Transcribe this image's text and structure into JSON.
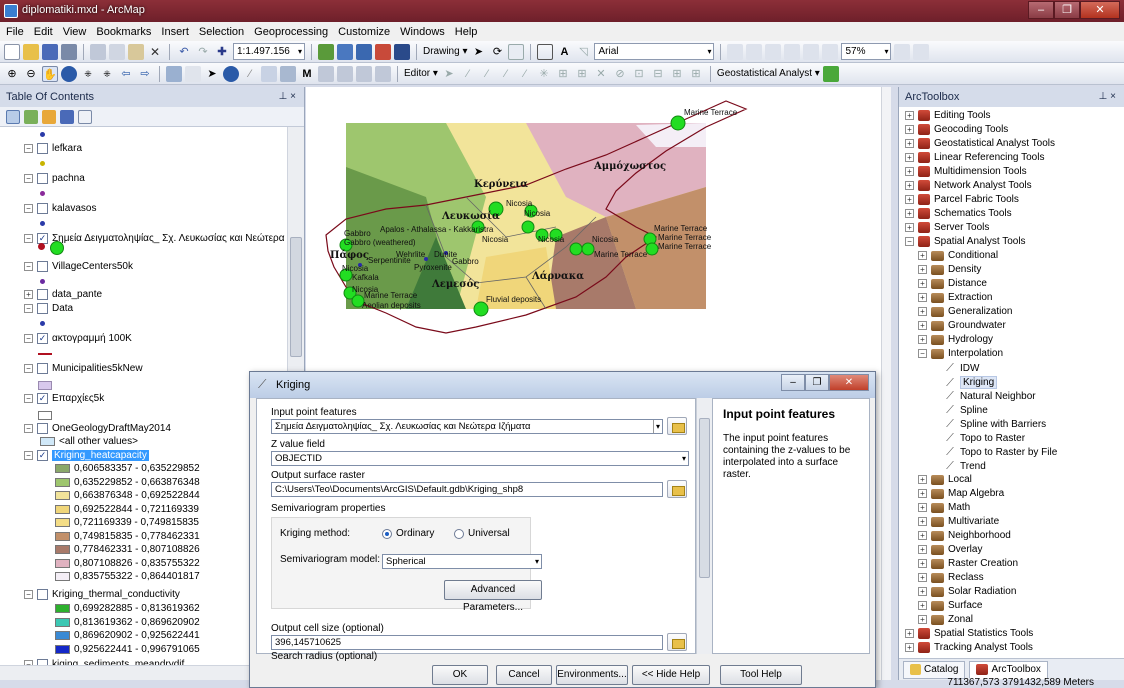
{
  "window": {
    "title": "diplomatiki.mxd - ArcMap",
    "controls": [
      "–",
      "❐",
      "✕"
    ]
  },
  "menu": [
    "File",
    "Edit",
    "View",
    "Bookmarks",
    "Insert",
    "Selection",
    "Geoprocessing",
    "Customize",
    "Windows",
    "Help"
  ],
  "toolbar": {
    "scale": "1:1.497.156",
    "drawing_label": "Drawing ▾",
    "font": "Arial",
    "zoom_percent": "57%",
    "editor_label": "Editor ▾",
    "geostat_label": "Geostatistical Analyst ▾"
  },
  "toc": {
    "title": "Table Of Contents",
    "pin": "⊥ ×",
    "layers": [
      {
        "name": "lefkara",
        "checked": false,
        "expanded": true,
        "symbol": "#c8b400"
      },
      {
        "name": "pachna",
        "checked": false,
        "expanded": true,
        "symbol": "#8a2a9a"
      },
      {
        "name": "kalavasos",
        "checked": false,
        "expanded": true,
        "symbol": "#2a3aa8"
      },
      {
        "name": "Σημεία Δειγματοληψίας_ Σχ. Λευκωσίας και Νεώτερα Ιζ",
        "checked": true,
        "expanded": true,
        "symbol": "#22cc22"
      },
      {
        "name": "VillageCenters50k",
        "checked": false,
        "expanded": true,
        "symbol": "#6a2aa0"
      },
      {
        "name": "data_pante",
        "checked": false,
        "expanded": false,
        "symbol": ""
      },
      {
        "name": "Data",
        "checked": false,
        "expanded": true,
        "symbol": "#2a3aa8"
      },
      {
        "name": "ακτογραμμή 100K",
        "checked": true,
        "expanded": true,
        "symbol": "#b01020"
      },
      {
        "name": "Municipalities5kNew",
        "checked": false,
        "expanded": true,
        "symbol": "#d8c8ec"
      },
      {
        "name": "Επαρχίες5k",
        "checked": true,
        "expanded": true,
        "symbol": "#ffffff"
      },
      {
        "name": "OneGeologyDraftMay2014",
        "checked": false,
        "expanded": true,
        "symbol": ""
      },
      {
        "name": "Kriging_heatcapacity",
        "checked": true,
        "expanded": true,
        "symbol": ""
      },
      {
        "name": "Kriging_thermal_conductivity",
        "checked": false,
        "expanded": true,
        "symbol": ""
      },
      {
        "name": "kiging_sediments_meandrydif",
        "checked": false,
        "expanded": true,
        "symbol": ""
      }
    ],
    "other_values": "<all other values>",
    "heat_classes": [
      {
        "label": "0,606583357 - 0,635229852",
        "color": "#8aa86a"
      },
      {
        "label": "0,635229852 - 0,663876348",
        "color": "#9ec66e"
      },
      {
        "label": "0,663876348 - 0,692522844",
        "color": "#f2e49a"
      },
      {
        "label": "0,692522844 - 0,721169339",
        "color": "#f0d67a"
      },
      {
        "label": "0,721169339 - 0,749815835",
        "color": "#f4dd86"
      },
      {
        "label": "0,749815835 - 0,778462331",
        "color": "#c2906a"
      },
      {
        "label": "0,778462331 - 0,807108826",
        "color": "#a87a6a"
      },
      {
        "label": "0,807108826 - 0,835755322",
        "color": "#e0b2c0"
      },
      {
        "label": "0,835755322 - 0,864401817",
        "color": "#f4eef6"
      }
    ],
    "thermal_classes": [
      {
        "label": "0,699282885 - 0,813619362",
        "color": "#2db02d"
      },
      {
        "label": "0,813619362 - 0,869620902",
        "color": "#3cc8b4"
      },
      {
        "label": "0,869620902 - 0,925622441",
        "color": "#3a8ad4"
      },
      {
        "label": "0,925622441 - 0,996791065",
        "color": "#1428c8"
      }
    ]
  },
  "map": {
    "district_labels": [
      "Κερύνεια",
      "Αμμόχωστος",
      "Λευκωσία",
      "Λάρνακα",
      "Πάφος",
      "Λεμεσός"
    ],
    "feature_labels": {
      "marine_1": "Marine Terrace",
      "nicosia": "Nicosia",
      "apalos": "Apalos - Athalassa - Kakkaristra",
      "gabbro": "Gabbro",
      "gabbro_w": "Gabbro (weathered)",
      "wehrlite": "Wehrlite",
      "dunite": "Dunite",
      "serpentinite": "Serpentinite",
      "pyroxenite": "Pyroxenite",
      "kafkala": "Kafkala",
      "aeolian": "Aeolian deposits",
      "fluvial": "Fluvial deposits"
    }
  },
  "toolbox": {
    "title": "ArcToolbox",
    "pin": "⊥ ×",
    "items": [
      {
        "label": "Editing Tools",
        "level": 0,
        "type": "toolbox",
        "exp": "+"
      },
      {
        "label": "Geocoding Tools",
        "level": 0,
        "type": "toolbox",
        "exp": "+"
      },
      {
        "label": "Geostatistical Analyst Tools",
        "level": 0,
        "type": "toolbox",
        "exp": "+"
      },
      {
        "label": "Linear Referencing Tools",
        "level": 0,
        "type": "toolbox",
        "exp": "+"
      },
      {
        "label": "Multidimension Tools",
        "level": 0,
        "type": "toolbox",
        "exp": "+"
      },
      {
        "label": "Network Analyst Tools",
        "level": 0,
        "type": "toolbox",
        "exp": "+"
      },
      {
        "label": "Parcel Fabric Tools",
        "level": 0,
        "type": "toolbox",
        "exp": "+"
      },
      {
        "label": "Schematics Tools",
        "level": 0,
        "type": "toolbox",
        "exp": "+"
      },
      {
        "label": "Server Tools",
        "level": 0,
        "type": "toolbox",
        "exp": "+"
      },
      {
        "label": "Spatial Analyst Tools",
        "level": 0,
        "type": "toolbox",
        "exp": "−"
      },
      {
        "label": "Conditional",
        "level": 1,
        "type": "toolset",
        "exp": "+"
      },
      {
        "label": "Density",
        "level": 1,
        "type": "toolset",
        "exp": "+"
      },
      {
        "label": "Distance",
        "level": 1,
        "type": "toolset",
        "exp": "+"
      },
      {
        "label": "Extraction",
        "level": 1,
        "type": "toolset",
        "exp": "+"
      },
      {
        "label": "Generalization",
        "level": 1,
        "type": "toolset",
        "exp": "+"
      },
      {
        "label": "Groundwater",
        "level": 1,
        "type": "toolset",
        "exp": "+"
      },
      {
        "label": "Hydrology",
        "level": 1,
        "type": "toolset",
        "exp": "+"
      },
      {
        "label": "Interpolation",
        "level": 1,
        "type": "toolset",
        "exp": "−"
      },
      {
        "label": "IDW",
        "level": 2,
        "type": "tool",
        "exp": ""
      },
      {
        "label": "Kriging",
        "level": 2,
        "type": "tool",
        "exp": "",
        "selected": true
      },
      {
        "label": "Natural Neighbor",
        "level": 2,
        "type": "tool",
        "exp": ""
      },
      {
        "label": "Spline",
        "level": 2,
        "type": "tool",
        "exp": ""
      },
      {
        "label": "Spline with Barriers",
        "level": 2,
        "type": "tool",
        "exp": ""
      },
      {
        "label": "Topo to Raster",
        "level": 2,
        "type": "tool",
        "exp": ""
      },
      {
        "label": "Topo to Raster by File",
        "level": 2,
        "type": "tool",
        "exp": ""
      },
      {
        "label": "Trend",
        "level": 2,
        "type": "tool",
        "exp": ""
      },
      {
        "label": "Local",
        "level": 1,
        "type": "toolset",
        "exp": "+"
      },
      {
        "label": "Map Algebra",
        "level": 1,
        "type": "toolset",
        "exp": "+"
      },
      {
        "label": "Math",
        "level": 1,
        "type": "toolset",
        "exp": "+"
      },
      {
        "label": "Multivariate",
        "level": 1,
        "type": "toolset",
        "exp": "+"
      },
      {
        "label": "Neighborhood",
        "level": 1,
        "type": "toolset",
        "exp": "+"
      },
      {
        "label": "Overlay",
        "level": 1,
        "type": "toolset",
        "exp": "+"
      },
      {
        "label": "Raster Creation",
        "level": 1,
        "type": "toolset",
        "exp": "+"
      },
      {
        "label": "Reclass",
        "level": 1,
        "type": "toolset",
        "exp": "+"
      },
      {
        "label": "Solar Radiation",
        "level": 1,
        "type": "toolset",
        "exp": "+"
      },
      {
        "label": "Surface",
        "level": 1,
        "type": "toolset",
        "exp": "+"
      },
      {
        "label": "Zonal",
        "level": 1,
        "type": "toolset",
        "exp": "+"
      },
      {
        "label": "Spatial Statistics Tools",
        "level": 0,
        "type": "toolbox",
        "exp": "+"
      },
      {
        "label": "Tracking Analyst Tools",
        "level": 0,
        "type": "toolbox",
        "exp": "+"
      }
    ],
    "tabs": [
      "Catalog",
      "ArcToolbox"
    ]
  },
  "status": {
    "coords": "711367,573  3791432,589 Meters"
  },
  "dialog": {
    "title": "Kriging",
    "input_label": "Input point features",
    "input_value": "Σημεία Δειγματοληψίας_ Σχ. Λευκωσίας και Νεώτερα Ιζήματα",
    "z_label": "Z value field",
    "z_value": "OBJECTID",
    "output_label": "Output surface raster",
    "output_value": "C:\\Users\\Teo\\Documents\\ArcGIS\\Default.gdb\\Kriging_shp8",
    "semivar_label": "Semivariogram properties",
    "method_label": "Kriging method:",
    "method_ordinary": "Ordinary",
    "method_universal": "Universal",
    "model_label": "Semivariogram model:",
    "model_value": "Spherical",
    "advanced": "Advanced Parameters...",
    "cellsize_label": "Output cell size (optional)",
    "cellsize_value": "396,145710625",
    "search_label": "Search radius (optional)",
    "help_title": "Input point features",
    "help_text": "The input point features containing the z-values to be interpolated into a surface raster.",
    "buttons": {
      "ok": "OK",
      "cancel": "Cancel",
      "env": "Environments...",
      "hide": "<< Hide Help",
      "toolhelp": "Tool Help"
    }
  }
}
